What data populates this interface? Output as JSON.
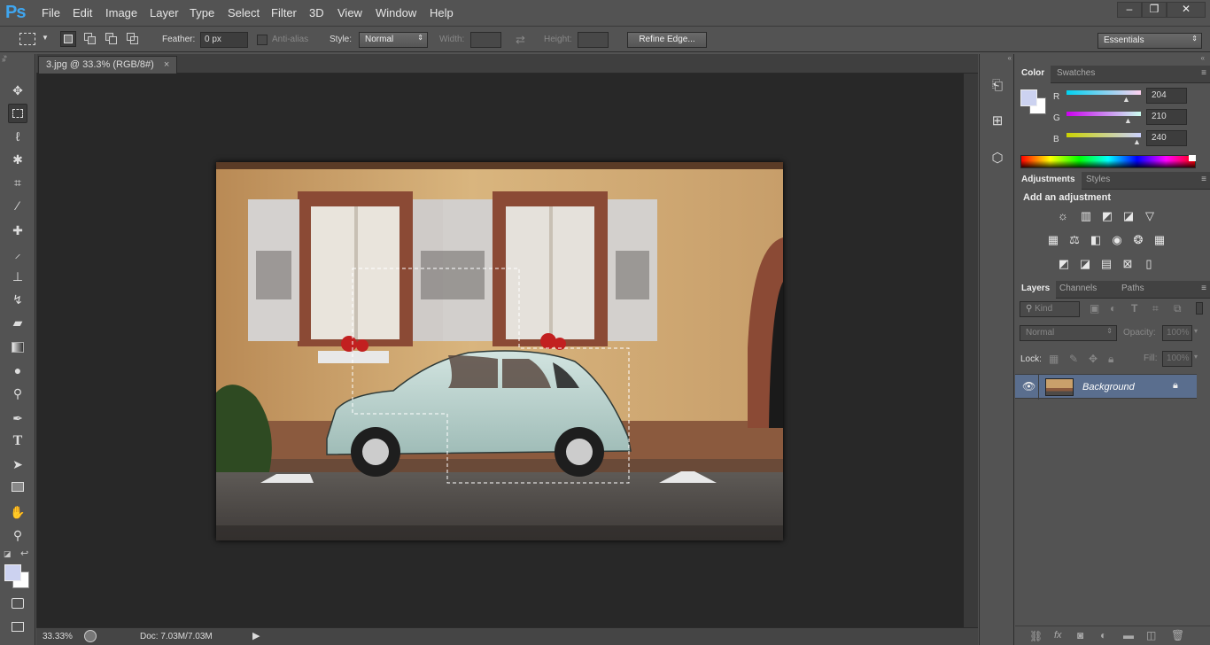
{
  "app": {
    "logo": "Ps"
  },
  "menu": [
    "File",
    "Edit",
    "Image",
    "Layer",
    "Type",
    "Select",
    "Filter",
    "3D",
    "View",
    "Window",
    "Help"
  ],
  "window_controls": {
    "minimize": "–",
    "restore": "❐",
    "close": "✕"
  },
  "options": {
    "feather_label": "Feather:",
    "feather_value": "0 px",
    "antialias_label": "Anti-alias",
    "style_label": "Style:",
    "style_value": "Normal",
    "width_label": "Width:",
    "height_label": "Height:",
    "refine_edge": "Refine Edge...",
    "workspace": "Essentials"
  },
  "document": {
    "tab_title": "3.jpg @ 33.3% (RGB/8#)",
    "tab_close": "×"
  },
  "status": {
    "zoom": "33.33%",
    "doc_info": "Doc: 7.03M/7.03M"
  },
  "color_panel": {
    "tabs": [
      "Color",
      "Swatches"
    ],
    "fg_color": "#ccd2f0",
    "channels": [
      {
        "name": "R",
        "value": "204"
      },
      {
        "name": "G",
        "value": "210"
      },
      {
        "name": "B",
        "value": "240"
      }
    ]
  },
  "adjustments_panel": {
    "tabs": [
      "Adjustments",
      "Styles"
    ],
    "heading": "Add an adjustment"
  },
  "layers_panel": {
    "tabs": [
      "Layers",
      "Channels",
      "Paths"
    ],
    "filter_kind": "Kind",
    "blend_mode": "Normal",
    "opacity_label": "Opacity:",
    "opacity_value": "100%",
    "lock_label": "Lock:",
    "fill_label": "Fill:",
    "fill_value": "100%",
    "layers": [
      {
        "name": "Background",
        "visible": true,
        "locked": true
      }
    ]
  },
  "colors": {
    "accent": "#3fa6f0",
    "selected_layer": "#5a6e8e",
    "canvas_bg": "#282828"
  }
}
